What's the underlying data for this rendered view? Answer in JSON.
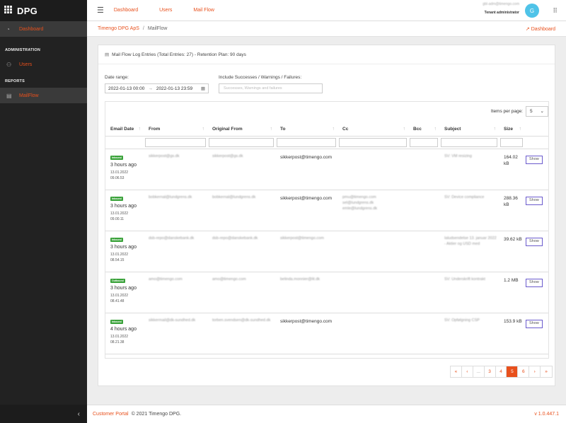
{
  "brand": {
    "logo_text": "DPG"
  },
  "sidebar": {
    "dashboard": "Dashboard",
    "admin_heading": "ADMINISTRATION",
    "users": "Users",
    "reports_heading": "REPORTS",
    "mailflow": "MailFlow"
  },
  "topbar": {
    "nav": [
      "Dashboard",
      "Users",
      "Mail Flow"
    ],
    "user_email": "gbl-adm@timengo.com",
    "user_role": "Tenant administrator",
    "avatar_initial": "G"
  },
  "breadcrumb": {
    "parent": "Timengo DPG ApS",
    "separator": "/",
    "current": "MailFlow",
    "dashboard_link": "Dashboard"
  },
  "card": {
    "title": "Mail Flow Log Entries (Total Entries: 27) - Retention Plan: 90 days",
    "date_range_label": "Date range:",
    "date_from": "2022-01-13 00:00",
    "date_sep": "→",
    "date_to": "2022-01-13 23:59",
    "include_label": "Include Successes / Warnings / Failures:",
    "include_placeholder": "Successes, Warnings and failures",
    "items_per_page_label": "Items per page:",
    "items_per_page_value": "5"
  },
  "table": {
    "headers": [
      "Email Date",
      "From",
      "Original From",
      "To",
      "Cc",
      "Bcc",
      "Subject",
      "Size"
    ],
    "rows": [
      {
        "badge": "Inbound",
        "ago": "3 hours ago",
        "date": "13.01.2022",
        "time": "09.06.53",
        "from": "sikkerpost@gs.dk",
        "orig_from": "sikkerpost@gs.dk",
        "to": "sikkerpost@timengo.com",
        "to_blur": false,
        "cc": "",
        "bcc": "",
        "subject": "SV: VM resizing",
        "size": "164.02 kB",
        "action": "Show"
      },
      {
        "badge": "Inbound",
        "ago": "3 hours ago",
        "date": "13.01.2022",
        "time": "09.00.11",
        "from": "bobkernal@lundgrens.dk",
        "orig_from": "bobkernal@lundgrens.dk",
        "to": "sikkerpost@timengo.com",
        "to_blur": false,
        "cc": "pmu@timengo.com sel@lundgrens.dk emle@lundgrens.dk",
        "bcc": "",
        "subject": "SV: Device compliance",
        "size": "288.36 kB",
        "action": "Show"
      },
      {
        "badge": "Inbound",
        "ago": "3 hours ago",
        "date": "13.01.2022",
        "time": "08.54.15",
        "from": "dsb-repo@danskebank.dk",
        "orig_from": "dsb-repo@danskebank.dk",
        "to": "sikkerpost@timengo.com",
        "to_blur": true,
        "cc": "",
        "bcc": "",
        "subject": "Ialudsendelse 13. januar 2022 - Aktier og USD med",
        "size": "39.62 kB",
        "action": "Show"
      },
      {
        "badge": "Outbound",
        "ago": "3 hours ago",
        "date": "13.01.2022",
        "time": "08.41.48",
        "from": "amo@timengo.com",
        "orig_from": "amo@timengo.com",
        "to": "belinda.monnier@lit.dk",
        "to_blur": true,
        "cc": "",
        "bcc": "",
        "subject": "SV: Underskrift kontrakt",
        "size": "1.2 MB",
        "action": "Show"
      },
      {
        "badge": "Inbound",
        "ago": "4 hours ago",
        "date": "13.01.2022",
        "time": "08.21.38",
        "from": "sikkermail@dk-sundhed.dk",
        "orig_from": "torben.svendsen@dk-sundhed.dk",
        "to": "sikkerpost@timengo.com",
        "to_blur": false,
        "cc": "",
        "bcc": "",
        "subject": "SV: Opfølgning CSP",
        "size": "153.9 kB",
        "action": "Show"
      }
    ]
  },
  "pagination": [
    "«",
    "‹",
    "...",
    "3",
    "4",
    "5",
    "6",
    "›",
    "»"
  ],
  "pagination_active": "5",
  "footer": {
    "portal": "Customer Portal",
    "copyright": "© 2021 Timengo DPG.",
    "version": "v 1.0.447.1"
  },
  "colors": {
    "accent": "#e8501c",
    "sidebar_bg": "#222222",
    "badge_green": "#3aa23a",
    "avatar": "#4fc3e8"
  }
}
